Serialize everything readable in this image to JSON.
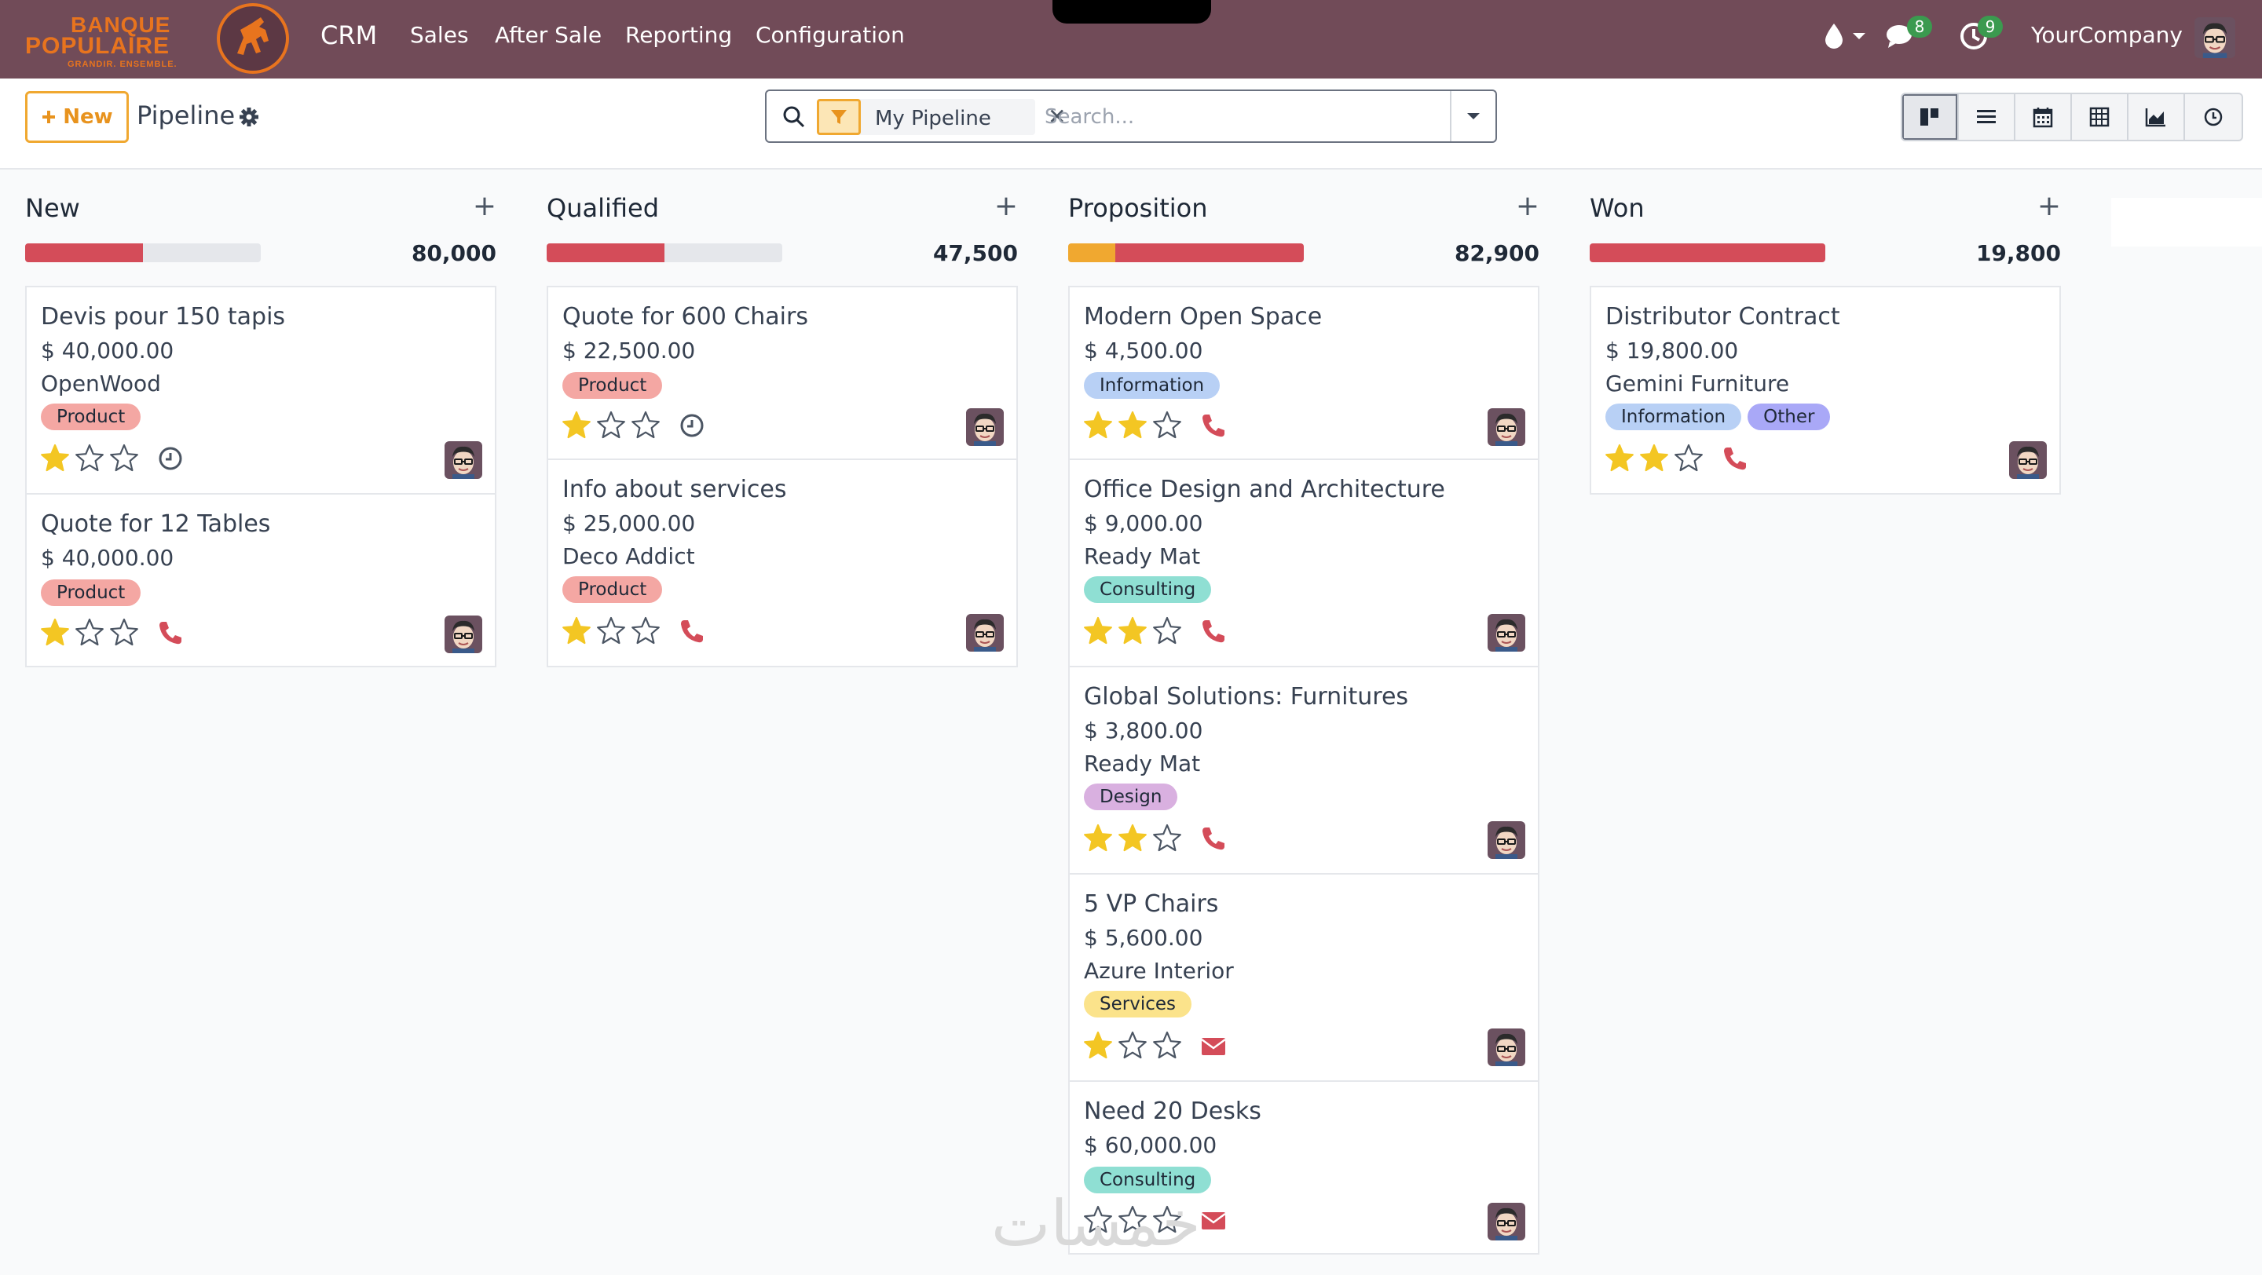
{
  "brand": {
    "logo_line1": "BANQUE",
    "logo_line2": "POPULAIRE",
    "logo_tagline": "GRANDIR. ENSEMBLE."
  },
  "nav": {
    "app": "CRM",
    "menus": [
      "Sales",
      "After Sale",
      "Reporting",
      "Configuration"
    ]
  },
  "systray": {
    "messages_count": "8",
    "activities_count": "9",
    "company": "YourCompany"
  },
  "control": {
    "new_label": "New",
    "title": "Pipeline",
    "facet_label": "My Pipeline",
    "search_placeholder": "Search...",
    "views": [
      "kanban-view-icon",
      "list-view-icon",
      "calendar-view-icon",
      "pivot-view-icon",
      "graph-view-icon",
      "activity-view-icon"
    ],
    "active_view": "kanban-view-icon"
  },
  "colors": {
    "topbar": "#714b58",
    "accent": "#f0a830",
    "progress_red": "#d44c59",
    "progress_orange": "#f0a830",
    "star_filled": "#f3c623",
    "phone": "#d44c59"
  },
  "tag_colors": {
    "Product": "#f4a7a3",
    "Information": "#b8d0f5",
    "Consulting": "#8fdfd3",
    "Design": "#d9b0e0",
    "Services": "#fbe38b",
    "Other": "#a9a8f7"
  },
  "columns": [
    {
      "title": "New",
      "total": "80,000",
      "progress": [
        {
          "color": "red",
          "fraction": 0.5
        }
      ],
      "cards": [
        {
          "name": "Devis pour 150 tapis",
          "amount": "$ 40,000.00",
          "customer": "OpenWood",
          "tags": [
            "Product"
          ],
          "stars": 1,
          "activity": "clock"
        },
        {
          "name": "Quote for 12 Tables",
          "amount": "$ 40,000.00",
          "customer": "",
          "tags": [
            "Product"
          ],
          "stars": 1,
          "activity": "phone"
        }
      ]
    },
    {
      "title": "Qualified",
      "total": "47,500",
      "progress": [
        {
          "color": "red",
          "fraction": 0.5
        }
      ],
      "cards": [
        {
          "name": "Quote for 600 Chairs",
          "amount": "$ 22,500.00",
          "customer": "",
          "tags": [
            "Product"
          ],
          "stars": 1,
          "activity": "clock"
        },
        {
          "name": "Info about services",
          "amount": "$ 25,000.00",
          "customer": "Deco Addict",
          "tags": [
            "Product"
          ],
          "stars": 1,
          "activity": "phone"
        }
      ]
    },
    {
      "title": "Proposition",
      "total": "82,900",
      "progress": [
        {
          "color": "orange",
          "fraction": 0.2
        },
        {
          "color": "red",
          "fraction": 0.8
        }
      ],
      "cards": [
        {
          "name": "Modern Open Space",
          "amount": "$ 4,500.00",
          "customer": "",
          "tags": [
            "Information"
          ],
          "stars": 2,
          "activity": "phone"
        },
        {
          "name": "Office Design and Architecture",
          "amount": "$ 9,000.00",
          "customer": "Ready Mat",
          "tags": [
            "Consulting"
          ],
          "stars": 2,
          "activity": "phone"
        },
        {
          "name": "Global Solutions: Furnitures",
          "amount": "$ 3,800.00",
          "customer": "Ready Mat",
          "tags": [
            "Design"
          ],
          "stars": 2,
          "activity": "phone"
        },
        {
          "name": "5 VP Chairs",
          "amount": "$ 5,600.00",
          "customer": "Azure Interior",
          "tags": [
            "Services"
          ],
          "stars": 1,
          "activity": "email"
        },
        {
          "name": "Need 20 Desks",
          "amount": "$ 60,000.00",
          "customer": "",
          "tags": [
            "Consulting"
          ],
          "stars": 0,
          "activity": "email"
        }
      ]
    },
    {
      "title": "Won",
      "total": "19,800",
      "progress": [
        {
          "color": "red",
          "fraction": 1.0
        }
      ],
      "cards": [
        {
          "name": "Distributor Contract",
          "amount": "$ 19,800.00",
          "customer": "Gemini Furniture",
          "tags": [
            "Information",
            "Other"
          ],
          "stars": 2,
          "activity": "phone"
        }
      ]
    }
  ],
  "watermark": "خمسات"
}
